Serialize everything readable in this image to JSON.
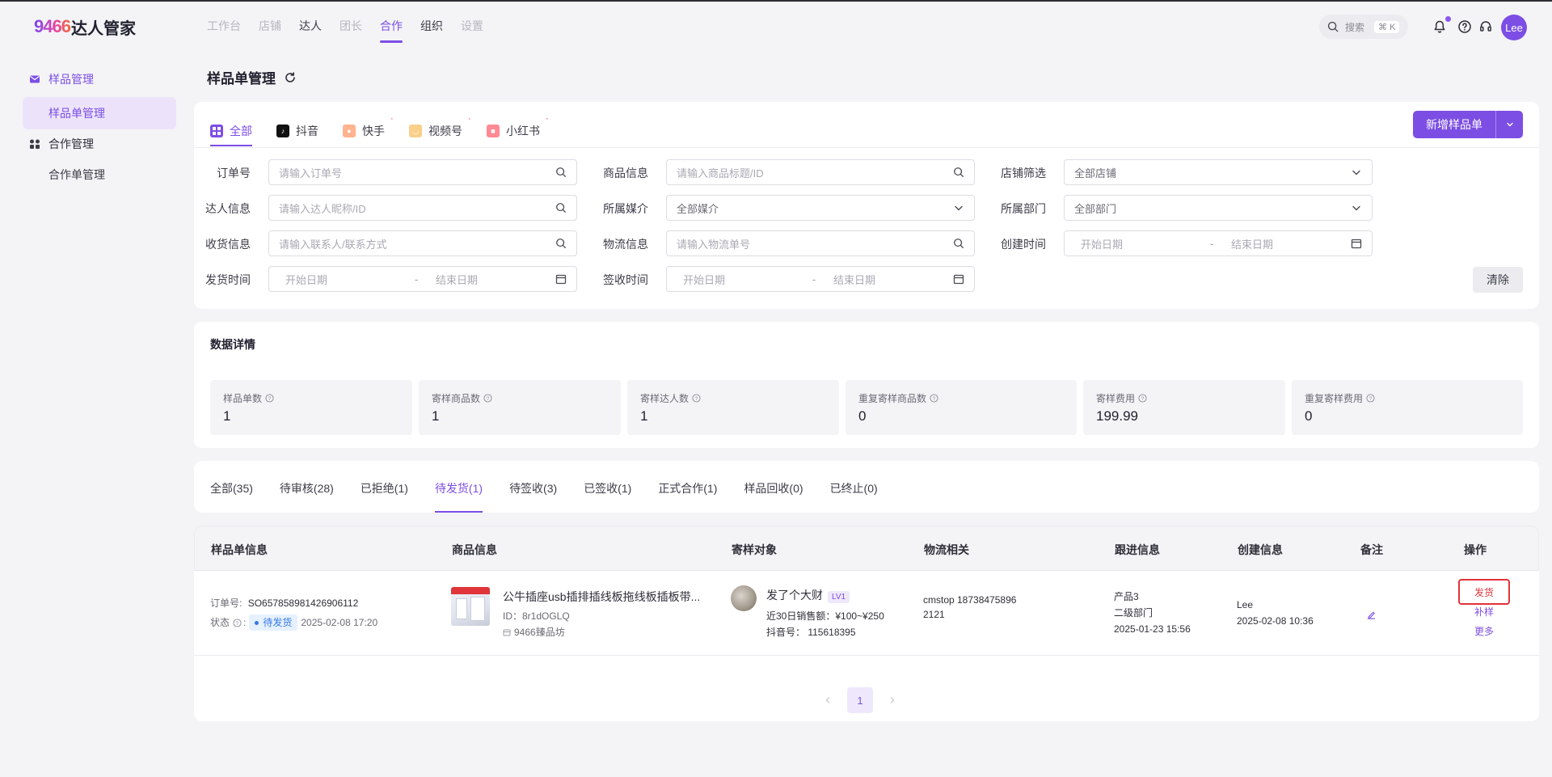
{
  "app": {
    "logo_num": "9466",
    "logo_text": "达人管家"
  },
  "topnav": [
    {
      "label": "工作台",
      "state": "disabled"
    },
    {
      "label": "店铺",
      "state": "disabled"
    },
    {
      "label": "达人",
      "state": "normal"
    },
    {
      "label": "团长",
      "state": "disabled"
    },
    {
      "label": "合作",
      "state": "active"
    },
    {
      "label": "组织",
      "state": "normal"
    },
    {
      "label": "设置",
      "state": "disabled"
    }
  ],
  "header": {
    "search_label": "搜索",
    "search_shortcut": "⌘ K",
    "avatar_text": "Lee"
  },
  "sidebar": {
    "groups": [
      {
        "label": "样品管理",
        "icon": "mail-icon",
        "items": [
          {
            "label": "样品单管理"
          }
        ]
      },
      {
        "label": "合作管理",
        "icon": "people-icon",
        "items": [
          {
            "label": "合作单管理"
          }
        ]
      }
    ]
  },
  "page": {
    "title": "样品单管理"
  },
  "platform_tabs": [
    {
      "label": "全部",
      "icon": "grid-icon",
      "color": "#7c4ee4"
    },
    {
      "label": "抖音",
      "icon": "douyin-icon",
      "color": "#111111"
    },
    {
      "label": "快手",
      "icon": "kuaishou-icon",
      "color": "#ff7a45"
    },
    {
      "label": "视频号",
      "icon": "shipinhao-icon",
      "color": "#f6a53a"
    },
    {
      "label": "小红书",
      "icon": "xiaohongshu-icon",
      "color": "#ff4d5a"
    }
  ],
  "new_button": {
    "label": "新增样品单"
  },
  "filters": {
    "order_no": {
      "label": "订单号",
      "placeholder": "请输入订单号"
    },
    "product": {
      "label": "商品信息",
      "placeholder": "请输入商品标题/ID"
    },
    "shop": {
      "label": "店铺筛选",
      "value": "全部店铺"
    },
    "kol": {
      "label": "达人信息",
      "placeholder": "请输入达人昵称/ID"
    },
    "media": {
      "label": "所属媒介",
      "value": "全部媒介"
    },
    "dept": {
      "label": "所属部门",
      "value": "全部部门"
    },
    "receiver": {
      "label": "收货信息",
      "placeholder": "请输入联系人/联系方式"
    },
    "logistics": {
      "label": "物流信息",
      "placeholder": "请输入物流单号"
    },
    "created": {
      "label": "创建时间",
      "start": "开始日期",
      "end": "结束日期"
    },
    "shipped": {
      "label": "发货时间",
      "start": "开始日期",
      "end": "结束日期"
    },
    "signed": {
      "label": "签收时间",
      "start": "开始日期",
      "end": "结束日期"
    },
    "range_sep": "-",
    "clear_label": "清除"
  },
  "stats": {
    "title": "数据详情",
    "items": [
      {
        "label": "样品单数",
        "value": "1"
      },
      {
        "label": "寄样商品数",
        "value": "1"
      },
      {
        "label": "寄样达人数",
        "value": "1"
      },
      {
        "label": "重复寄样商品数",
        "value": "0"
      },
      {
        "label": "寄样费用",
        "value": "199.99"
      },
      {
        "label": "重复寄样费用",
        "value": "0"
      }
    ]
  },
  "status_tabs": [
    {
      "label": "全部(35)"
    },
    {
      "label": "待审核(28)"
    },
    {
      "label": "已拒绝(1)"
    },
    {
      "label": "待发货(1)"
    },
    {
      "label": "待签收(3)"
    },
    {
      "label": "已签收(1)"
    },
    {
      "label": "正式合作(1)"
    },
    {
      "label": "样品回收(0)"
    },
    {
      "label": "已终止(0)"
    }
  ],
  "table": {
    "headers": [
      "样品单信息",
      "商品信息",
      "寄样对象",
      "物流相关",
      "跟进信息",
      "创建信息",
      "备注",
      "操作"
    ],
    "row": {
      "order_label": "订单号:",
      "order_no": "SO657858981426906112",
      "status_label": "状态",
      "status_badge": "待发货",
      "status_time": "2025-02-08 17:20",
      "product_title": "公牛插座usb插排插线板拖线板插板带...",
      "product_id": "ID：8r1dOGLQ",
      "shop_name": "9466臻品坊",
      "kol_name": "发了个大财",
      "kol_level": "LV1",
      "kol_sales": "近30日销售额：¥100~¥250",
      "kol_douyin": "抖音号：  115618395",
      "logistics_line1": "cmstop  18738475896",
      "logistics_line2": "2121",
      "follow_line1": "产品3",
      "follow_line2": "二级部门",
      "follow_line3": "2025-01-23 15:56",
      "creator": "Lee",
      "created_time": "2025-02-08 10:36",
      "actions": [
        "发货",
        "补样",
        "更多"
      ]
    }
  },
  "pagination": {
    "current": "1"
  }
}
